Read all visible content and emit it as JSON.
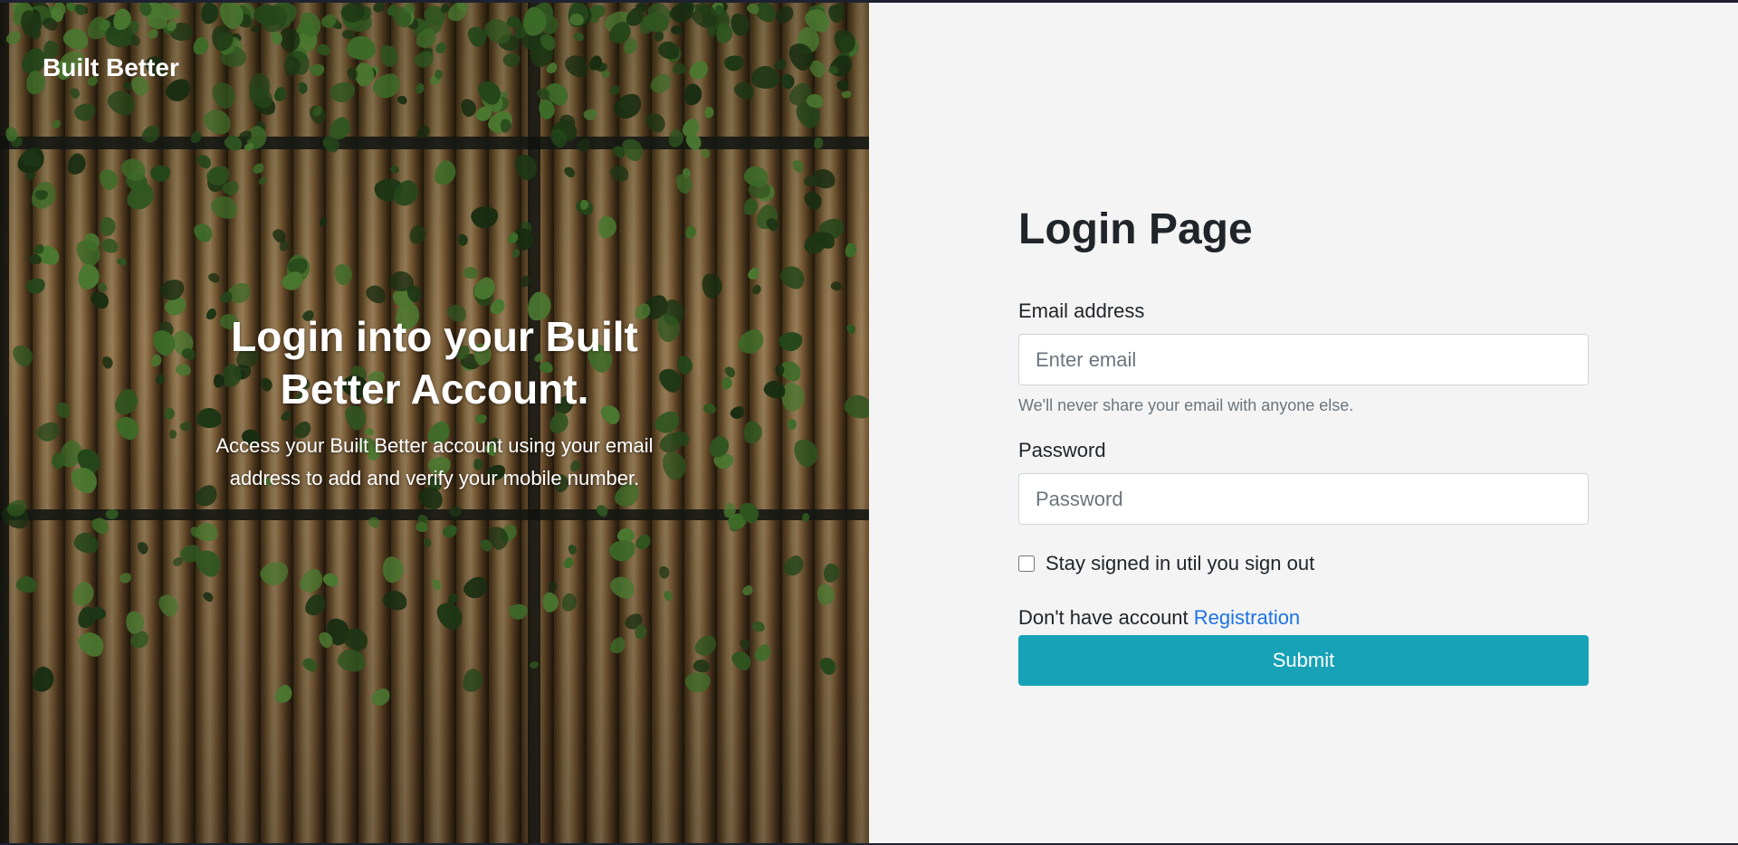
{
  "brand": "Built Better",
  "hero": {
    "title": "Login into your Built Better Account.",
    "subtitle": "Access your Built Better account using your email address to add and verify your mobile number."
  },
  "form": {
    "title": "Login Page",
    "email_label": "Email address",
    "email_placeholder": "Enter email",
    "email_value": "",
    "email_help": "We'll never share your email with anyone else.",
    "password_label": "Password",
    "password_placeholder": "Password",
    "password_value": "",
    "stay_signed_in_label": "Stay signed in util you sign out",
    "stay_signed_in_checked": false,
    "no_account_text": "Don't have account",
    "registration_link": "Registration",
    "submit_label": "Submit"
  },
  "colors": {
    "form_background": "#f4f4f4",
    "submit_button": "#17a2b8",
    "link": "#1b73e8",
    "help_text": "#6c757d"
  }
}
